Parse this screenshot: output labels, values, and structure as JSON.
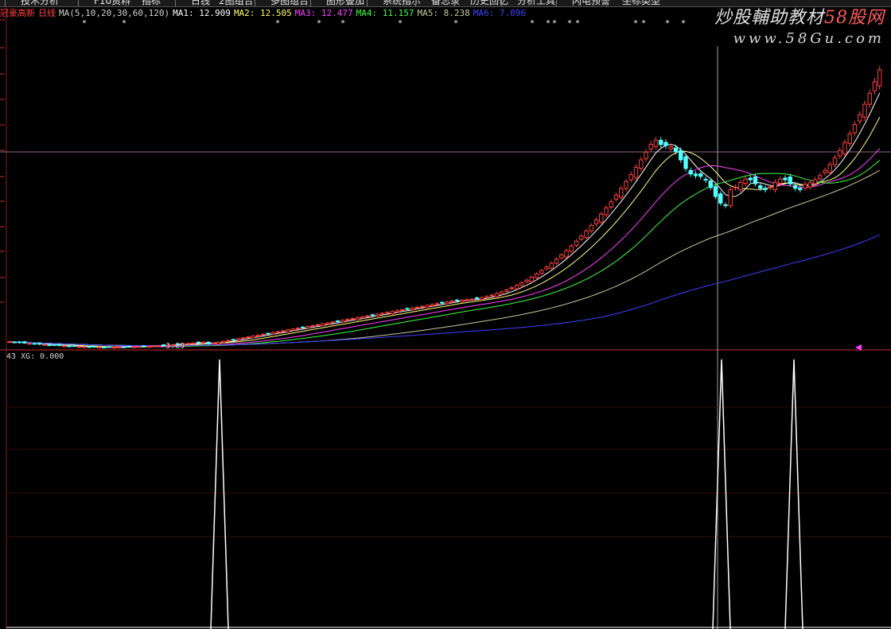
{
  "toolbar": {
    "buttons": [
      "技术分析",
      "F10资料",
      "指标",
      "日线",
      "2图组合",
      "多图组合",
      "图形叠加",
      "系统指示",
      "备忘录",
      "历史回忆",
      "分析工具",
      "闪电预警",
      "坐标类型"
    ]
  },
  "stock": {
    "name": "冠豪高新",
    "period": "日线"
  },
  "ma": {
    "params": "MA(5,10,20,30,60,120)",
    "ma1": "MA1: 12.909",
    "ma2": "MA2: 12.505",
    "ma3": "MA3: 12.477",
    "ma4": "MA4: 11.157",
    "ma5": "MA5: 8.238",
    "ma6": "MA6: 7.096",
    "colors": {
      "ma1": "#ffffff",
      "ma2": "#ffff60",
      "ma3": "#ff40ff",
      "ma4": "#40ff40",
      "ma5": "#c8c8a0",
      "ma6": "#4040ff"
    }
  },
  "watermark": {
    "title": "炒股輔助教材",
    "brand": "58股网",
    "url": "www.58Gu.com"
  },
  "low_marker": "←3.09",
  "indicator": {
    "label": "XG: 0.000",
    "left_num": "43"
  },
  "colors": {
    "up": "#ff4040",
    "down": "#54ffff",
    "grid": "#8b1a1a",
    "cursor": "#a0a0a0"
  },
  "chart_data": {
    "type": "candlestick",
    "x_unit": "trading day index",
    "xg_signal": {
      "type": "spike",
      "spikes_at_days": [
        46,
        156,
        171
      ],
      "values": [
        0,
        1
      ]
    }
  }
}
